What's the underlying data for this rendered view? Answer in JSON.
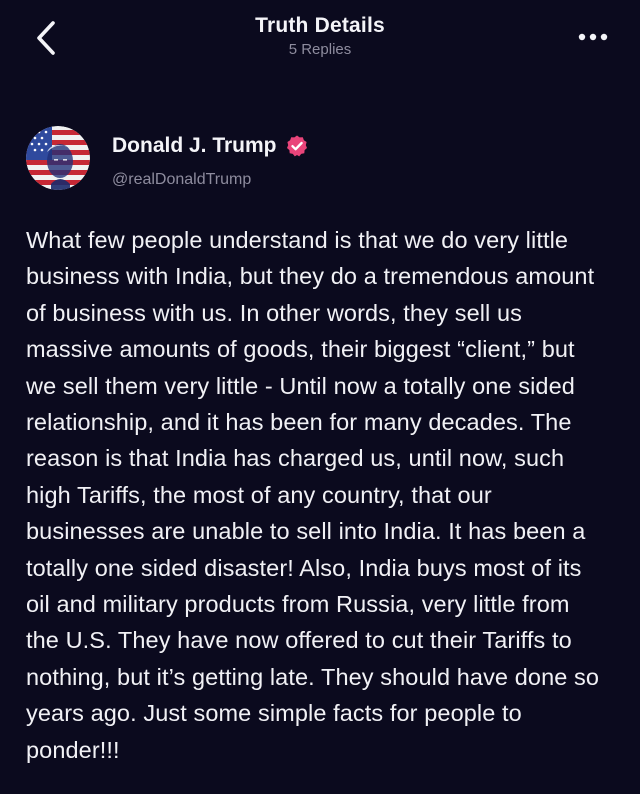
{
  "header": {
    "title": "Truth Details",
    "subtitle": "5 Replies",
    "back_icon": "chevron-left-icon",
    "more_icon": "more-horizontal-icon"
  },
  "author": {
    "name": "Donald J. Trump",
    "handle": "@realDonaldTrump",
    "verified_icon": "verified-badge-icon",
    "verified_color": "#e9447a"
  },
  "post": {
    "text": "What few people understand is that we do very little business with India, but they do a tremendous amount of business with us. In other words, they sell us massive amounts of goods, their biggest “client,” but we sell them very little - Until now a totally one sided relationship, and it has been for many decades. The reason is that India has charged us, until now, such high Tariffs, the most of any country, that our businesses are unable to sell into India. It has been a totally one sided disaster! Also, India buys most of its oil and military products from Russia, very little from the U.S. They have now offered to cut their Tariffs to nothing, but it’s getting late. They should have done so years ago. Just some simple facts for people to ponder!!!"
  },
  "colors": {
    "background": "#0b0a1e",
    "text_primary": "#f4f4f8",
    "text_secondary": "#8e8c9e"
  }
}
